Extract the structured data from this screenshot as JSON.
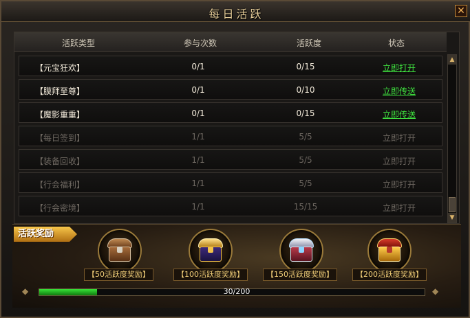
{
  "window": {
    "title": "每日活跃",
    "close_glyph": "✕"
  },
  "table": {
    "headers": [
      "活跃类型",
      "参与次数",
      "活跃度",
      "状态"
    ],
    "rows": [
      {
        "name": "【元宝狂欢】",
        "count": "0/1",
        "activity": "0/15",
        "status": "立即打开",
        "state": "active"
      },
      {
        "name": "【膜拜至尊】",
        "count": "0/1",
        "activity": "0/10",
        "status": "立即传送",
        "state": "active"
      },
      {
        "name": "【魔影重重】",
        "count": "0/1",
        "activity": "0/15",
        "status": "立即传送",
        "state": "active"
      },
      {
        "name": "【每日签到】",
        "count": "1/1",
        "activity": "5/5",
        "status": "立即打开",
        "state": "done"
      },
      {
        "name": "【装备回收】",
        "count": "1/1",
        "activity": "5/5",
        "status": "立即打开",
        "state": "done"
      },
      {
        "name": "【行会福利】",
        "count": "1/1",
        "activity": "5/5",
        "status": "立即打开",
        "state": "done"
      },
      {
        "name": "【行会密境】",
        "count": "1/1",
        "activity": "15/15",
        "status": "立即打开",
        "state": "done"
      }
    ]
  },
  "rewards": {
    "tag": "活跃奖励",
    "chests": [
      {
        "label": "【50活跃度奖励】",
        "icon": "wooden-chest-icon"
      },
      {
        "label": "【100活跃度奖励】",
        "icon": "golden-chest-icon"
      },
      {
        "label": "【150活跃度奖励】",
        "icon": "silver-chest-icon"
      },
      {
        "label": "【200活跃度奖励】",
        "icon": "red-gold-chest-icon"
      }
    ],
    "progress": {
      "current": 30,
      "max": 200,
      "text": "30/200",
      "fraction": 0.15
    }
  },
  "colors": {
    "accent_gold": "#e8cf9a",
    "link_green": "#3fe23f",
    "disabled": "#6d6760",
    "progress_green": "#39e239"
  }
}
